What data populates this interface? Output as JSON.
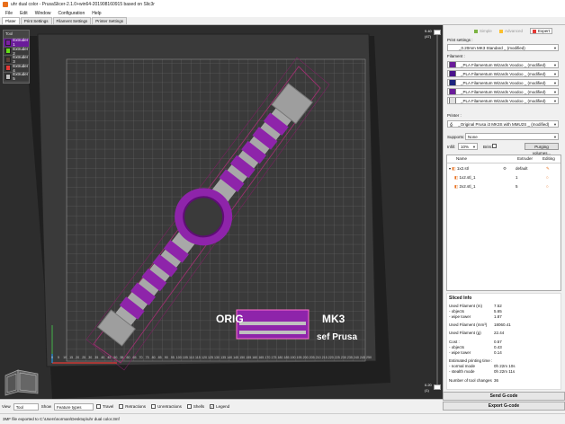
{
  "window": {
    "title": "uhr dual color - PrusaSlicer-2.1.0+win64-201908160915 based on Slic3r"
  },
  "menu": [
    "File",
    "Edit",
    "Window",
    "Configuration",
    "Help"
  ],
  "tabs": [
    "Plater",
    "Print Settings",
    "Filament Settings",
    "Printer Settings"
  ],
  "extruder_panel": {
    "header": "Tool",
    "items": [
      {
        "label": "Extruder 1",
        "color": "#7b1fa2"
      },
      {
        "label": "Extruder 2",
        "color": "#64dd17"
      },
      {
        "label": "Extruder 3",
        "color": "#5d4037"
      },
      {
        "label": "Extruder 4",
        "color": "#e53935"
      },
      {
        "label": "Extruder 5",
        "color": "#bdbdbd"
      }
    ]
  },
  "bed": {
    "logo_left": "ORIG",
    "logo_right": "MK3",
    "logo_bottom": "sef Prusa",
    "ticks": [
      "0",
      "5",
      "10",
      "15",
      "20",
      "25",
      "30",
      "35",
      "40",
      "45",
      "50",
      "55",
      "60",
      "65",
      "70",
      "75",
      "80",
      "85",
      "90",
      "95",
      "100",
      "105",
      "110",
      "115",
      "120",
      "125",
      "130",
      "135",
      "140",
      "145",
      "150",
      "155",
      "160",
      "165",
      "170",
      "175",
      "180",
      "185",
      "190",
      "195",
      "200",
      "205",
      "210",
      "215",
      "220",
      "225",
      "230",
      "235",
      "240",
      "245",
      "250"
    ]
  },
  "vslider": {
    "top_value": "9.40",
    "top_layer": "(47)",
    "bottom_value": "0.20",
    "bottom_layer": "(1)"
  },
  "modes": [
    {
      "label": "Simple",
      "color": "#7cb342"
    },
    {
      "label": "Advanced",
      "color": "#fbc02d"
    },
    {
      "label": "Expert",
      "color": "#e53935"
    }
  ],
  "print_settings": {
    "label": "Print settings :",
    "value": "_0.20mm MK3 Standard _ (modified)"
  },
  "filament": {
    "label": "Filament :",
    "items": [
      {
        "value": "_PLA Filamentum Wizards Voodoo _ (modified)",
        "color": "#6a1b9a"
      },
      {
        "value": "_PLA Filamentum Wizards Voodoo _ (modified)",
        "color": "#4a148c"
      },
      {
        "value": "_PLA Filamentum Wizards Voodoo _ (modified)",
        "color": "#1a237e"
      },
      {
        "value": "_PLA Filamentum Wizards Voodoo _ (modified)",
        "color": "#6a1b9a"
      },
      {
        "value": "_PLA Filamentum Wizards Voodoo _ (modified)",
        "color": "#e0e0e0"
      }
    ]
  },
  "printer": {
    "label": "Printer :",
    "value": "_Original Prusa i3 MK3S with MMU2S _ (modified)"
  },
  "supports": {
    "label": "Supports:",
    "value": "None"
  },
  "infill": {
    "label": "Infill:",
    "value": "10%",
    "brim_label": "Brim:",
    "purging_button": "Purging volumes..."
  },
  "objects": {
    "col_name": "Name",
    "col_extruder": "Extruder",
    "col_editing": "Editing",
    "rows": [
      {
        "name": "1x2.stl",
        "extruder": "default"
      },
      {
        "name": "1x2.stl_1",
        "extruder": "1"
      },
      {
        "name": "2x2.stl_1",
        "extruder": "5"
      }
    ]
  },
  "sliced_info": {
    "title": "Sliced Info",
    "rows": [
      {
        "k": "Used Filament (m)",
        "v": "7.52"
      },
      {
        "k": "  - objects",
        "v": "5.65"
      },
      {
        "k": "  - wipe tower",
        "v": "1.87"
      },
      {
        "k": "Used Filament (mm³)",
        "v": "18060.41"
      },
      {
        "k": "Used Filament (g)",
        "v": "22.44"
      },
      {
        "k": "Cost :",
        "v": "0.57"
      },
      {
        "k": "  - objects",
        "v": "0.43"
      },
      {
        "k": "  - wipe tower",
        "v": "0.14"
      },
      {
        "k": "Estimated printing time :",
        "v": ""
      },
      {
        "k": "  - normal mode",
        "v": "0h 22m 10s"
      },
      {
        "k": "  - stealth mode",
        "v": "0h 22m 11s"
      },
      {
        "k": "Number of tool changes",
        "v": "36"
      }
    ]
  },
  "buttons": {
    "send_gcode": "Send G-code",
    "export_gcode": "Export G-code"
  },
  "bottom": {
    "view_label": "View",
    "view_value": "Tool",
    "show_label": "Show",
    "show_value": "Feature types",
    "checks": [
      {
        "label": "Travel",
        "checked": false
      },
      {
        "label": "Retractions",
        "checked": false
      },
      {
        "label": "Unretractions",
        "checked": false
      },
      {
        "label": "Shells",
        "checked": false
      },
      {
        "label": "Legend",
        "checked": true
      }
    ]
  },
  "status": "3MF file exported to C:\\Users\\norman\\Desktop\\uhr dual color.3mf"
}
